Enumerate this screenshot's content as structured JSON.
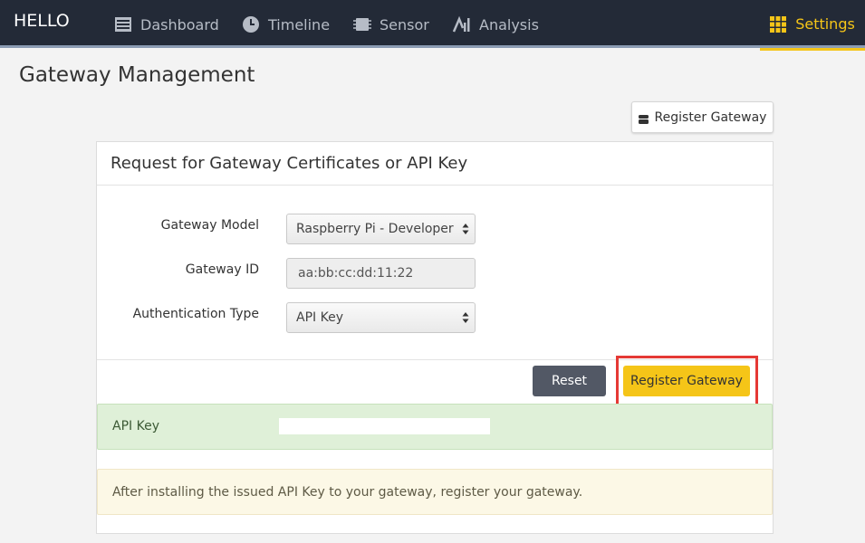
{
  "nav": {
    "brand": "HELLO",
    "items": [
      {
        "label": "Dashboard",
        "icon": "dashboard-icon"
      },
      {
        "label": "Timeline",
        "icon": "clock-icon"
      },
      {
        "label": "Sensor",
        "icon": "chip-icon"
      },
      {
        "label": "Analysis",
        "icon": "analysis-icon"
      }
    ],
    "settings": {
      "label": "Settings",
      "icon": "grid-icon"
    },
    "accent_color": "#f5c518"
  },
  "page": {
    "title": "Gateway Management",
    "register_button_top": "Register Gateway"
  },
  "panel": {
    "heading": "Request for Gateway Certificates or API Key",
    "form": {
      "model_label": "Gateway Model",
      "model_value": "Raspberry Pi - Developer",
      "id_label": "Gateway ID",
      "id_value": "aa:bb:cc:dd:11:22",
      "auth_label": "Authentication Type",
      "auth_value": "API Key"
    },
    "reset_label": "Reset",
    "register_label": "Register Gateway",
    "api_key_label": "API Key",
    "api_key_value": "",
    "notice": "After installing the issued API Key to your gateway, register your gateway."
  }
}
